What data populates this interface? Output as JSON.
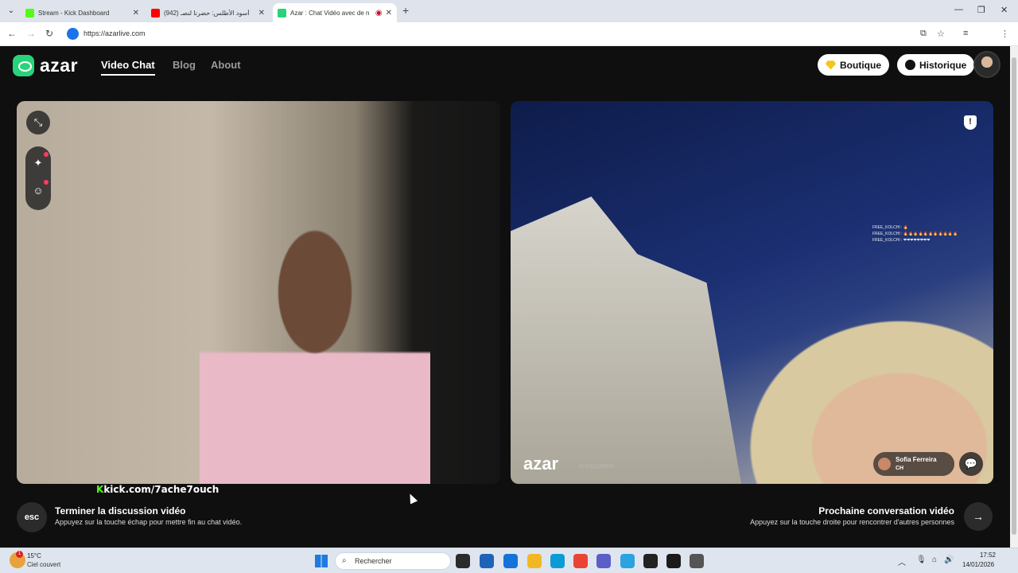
{
  "browser": {
    "tabs": [
      {
        "title": "Stream - Kick Dashboard",
        "color": "#53fc18"
      },
      {
        "title": "(942) أسود الأطلس: حضرنا لنصـ",
        "color": "#ff0000"
      },
      {
        "title": "Azar : Chat Vidéo avec de n",
        "color": "#28d37a"
      }
    ],
    "url": "https://azarlive.com"
  },
  "site": {
    "logo": "azar",
    "menu": [
      "Video Chat",
      "Blog",
      "About"
    ],
    "boutique": "Boutique",
    "historique": "Historique"
  },
  "remote": {
    "watermark": "azar",
    "watermark_id": "ID:V+EQGRGIH",
    "user_name": "Sofia Ferreira",
    "user_country": "CH",
    "overlay_lines": [
      "FREE_KOLCHI : 🔥",
      "FREE_KOLCHI : 🔥🔥🔥🔥🔥🔥🔥🔥🔥🔥🔥",
      "FREE_KOLCHI : ❤❤❤❤❤❤❤❤"
    ],
    "shield_label": "!"
  },
  "kick_overlay": {
    "prefix": "K",
    "text": "kick.com/7ache7ouch"
  },
  "controls": {
    "esc_label": "esc",
    "end_title": "Terminer la discussion vidéo",
    "end_sub": "Appuyez sur la touche échap pour mettre fin au chat vidéo.",
    "next_title": "Prochaine conversation vidéo",
    "next_sub": "Appuyez sur la touche droite pour rencontrer d'autres personnes",
    "next_icon": "→"
  },
  "taskbar": {
    "temp": "15°C",
    "condition": "Ciel couvert",
    "weather_badge": "1",
    "search_placeholder": "Rechercher",
    "time": "17:52",
    "date": "14/01/2026",
    "app_colors": [
      "#2b2b2b",
      "#1f63b8",
      "#1572d8",
      "#f2b824",
      "#0d9bd6",
      "#ea4335",
      "#5b5fc7",
      "#2aa3df",
      "#222222",
      "#1a1a1a",
      "#555555"
    ]
  }
}
